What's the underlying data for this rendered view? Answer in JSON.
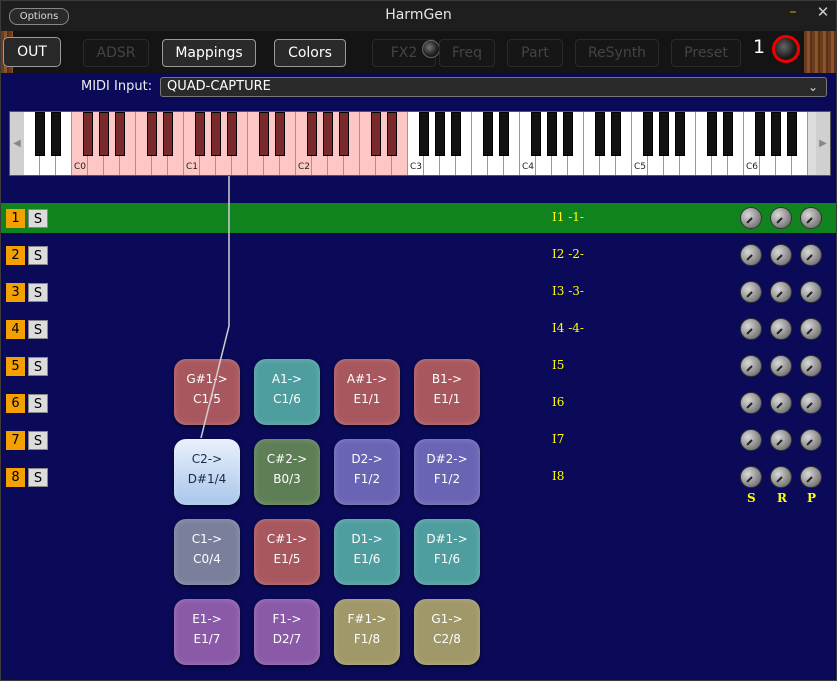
{
  "title": "HarmGen",
  "options_label": "Options",
  "window_controls": {
    "minimize": "–",
    "close": "✕"
  },
  "tabs": [
    {
      "label": "OUT",
      "active": true
    },
    {
      "label": "ADSR",
      "active": false
    },
    {
      "label": "Mappings",
      "active": true
    },
    {
      "label": "Colors",
      "active": true
    },
    {
      "label": "FX2",
      "active": false
    },
    {
      "label": "Freq",
      "active": false
    },
    {
      "label": "Part",
      "active": false
    },
    {
      "label": "ReSynth",
      "active": false
    },
    {
      "label": "Preset",
      "active": false
    }
  ],
  "preset_number": "1",
  "midi": {
    "label": "MIDI Input:",
    "value": "QUAD-CAPTURE"
  },
  "keyboard": {
    "octave_labels": [
      "C0",
      "C1",
      "C2",
      "C3",
      "C4",
      "C5",
      "C6"
    ],
    "highlighted_range": "C0–C3",
    "scroll_left": "◀",
    "scroll_right": "▶"
  },
  "channels": [
    {
      "num": "1",
      "solo": "S",
      "instrument": "I1 -1-",
      "selected": true
    },
    {
      "num": "2",
      "solo": "S",
      "instrument": "I2 -2-",
      "selected": false
    },
    {
      "num": "3",
      "solo": "S",
      "instrument": "I3 -3-",
      "selected": false
    },
    {
      "num": "4",
      "solo": "S",
      "instrument": "I4 -4-",
      "selected": false
    },
    {
      "num": "5",
      "solo": "S",
      "instrument": "I5",
      "selected": false
    },
    {
      "num": "6",
      "solo": "S",
      "instrument": "I6",
      "selected": false
    },
    {
      "num": "7",
      "solo": "S",
      "instrument": "I7",
      "selected": false
    },
    {
      "num": "8",
      "solo": "S",
      "instrument": "I8",
      "selected": false
    }
  ],
  "knob_labels": [
    "S",
    "R",
    "P"
  ],
  "pads": [
    {
      "top": "G#1->",
      "bottom": "C1/5",
      "color": "#a8575e"
    },
    {
      "top": "A1->",
      "bottom": "C1/6",
      "color": "#4e9ea0"
    },
    {
      "top": "A#1->",
      "bottom": "E1/1",
      "color": "#a8575e"
    },
    {
      "top": "B1->",
      "bottom": "E1/1",
      "color": "#a8575e"
    },
    {
      "top": "C2->",
      "bottom": "D#1/4",
      "color": "#c8dcf4",
      "selected": true
    },
    {
      "top": "C#2->",
      "bottom": "B0/3",
      "color": "#5e7e56"
    },
    {
      "top": "D2->",
      "bottom": "F1/2",
      "color": "#6a64b4"
    },
    {
      "top": "D#2->",
      "bottom": "F1/2",
      "color": "#6a64b4"
    },
    {
      "top": "C1->",
      "bottom": "C0/4",
      "color": "#7a809c"
    },
    {
      "top": "C#1->",
      "bottom": "E1/5",
      "color": "#a8575e"
    },
    {
      "top": "D1->",
      "bottom": "E1/6",
      "color": "#4e9ea0"
    },
    {
      "top": "D#1->",
      "bottom": "F1/6",
      "color": "#4e9ea0"
    },
    {
      "top": "E1->",
      "bottom": "E1/7",
      "color": "#8a5aa8"
    },
    {
      "top": "F1->",
      "bottom": "D2/7",
      "color": "#8a5aa8"
    },
    {
      "top": "F#1->",
      "bottom": "F1/8",
      "color": "#a09868"
    },
    {
      "top": "G1->",
      "bottom": "C2/8",
      "color": "#a09868"
    }
  ],
  "colors": {
    "background": "#0a0a58",
    "selected_row": "#10821e",
    "channel": "#f4a000",
    "instrument_text": "#ffff00"
  }
}
